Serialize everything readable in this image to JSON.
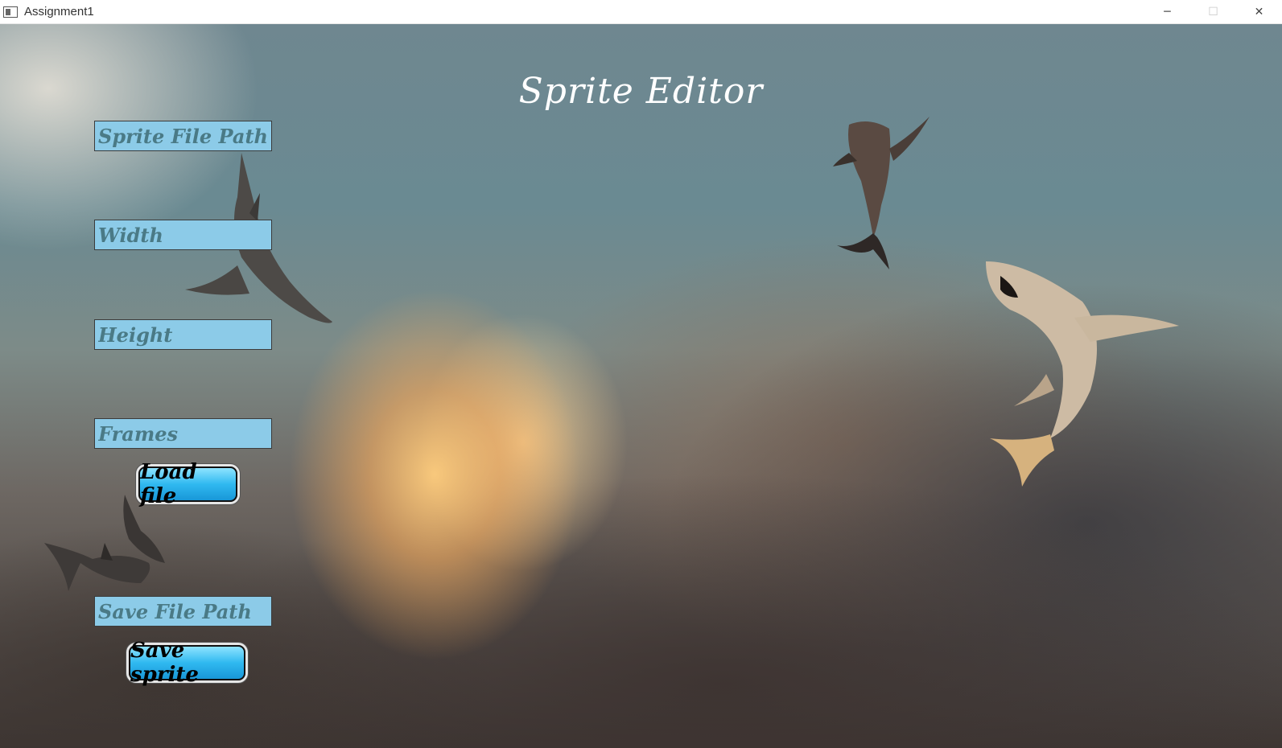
{
  "window": {
    "title": "Assignment1",
    "controls": {
      "minimize": "─",
      "maximize": "☐",
      "close": "✕"
    }
  },
  "app": {
    "heading": "Sprite  Editor"
  },
  "form": {
    "sprite_path_placeholder": "Sprite File Path",
    "width_placeholder": "Width",
    "height_placeholder": "Height",
    "frames_placeholder": "Frames",
    "load_label": "Load file",
    "save_path_placeholder": "Save File Path",
    "save_label": "Save sprite"
  },
  "colors": {
    "field_bg": "#8ccbe8",
    "field_text": "#4a7a86",
    "button_bg": "#30b9f0"
  },
  "icons": [
    "app-window-icon",
    "minimize-icon",
    "maximize-icon",
    "close-icon"
  ]
}
